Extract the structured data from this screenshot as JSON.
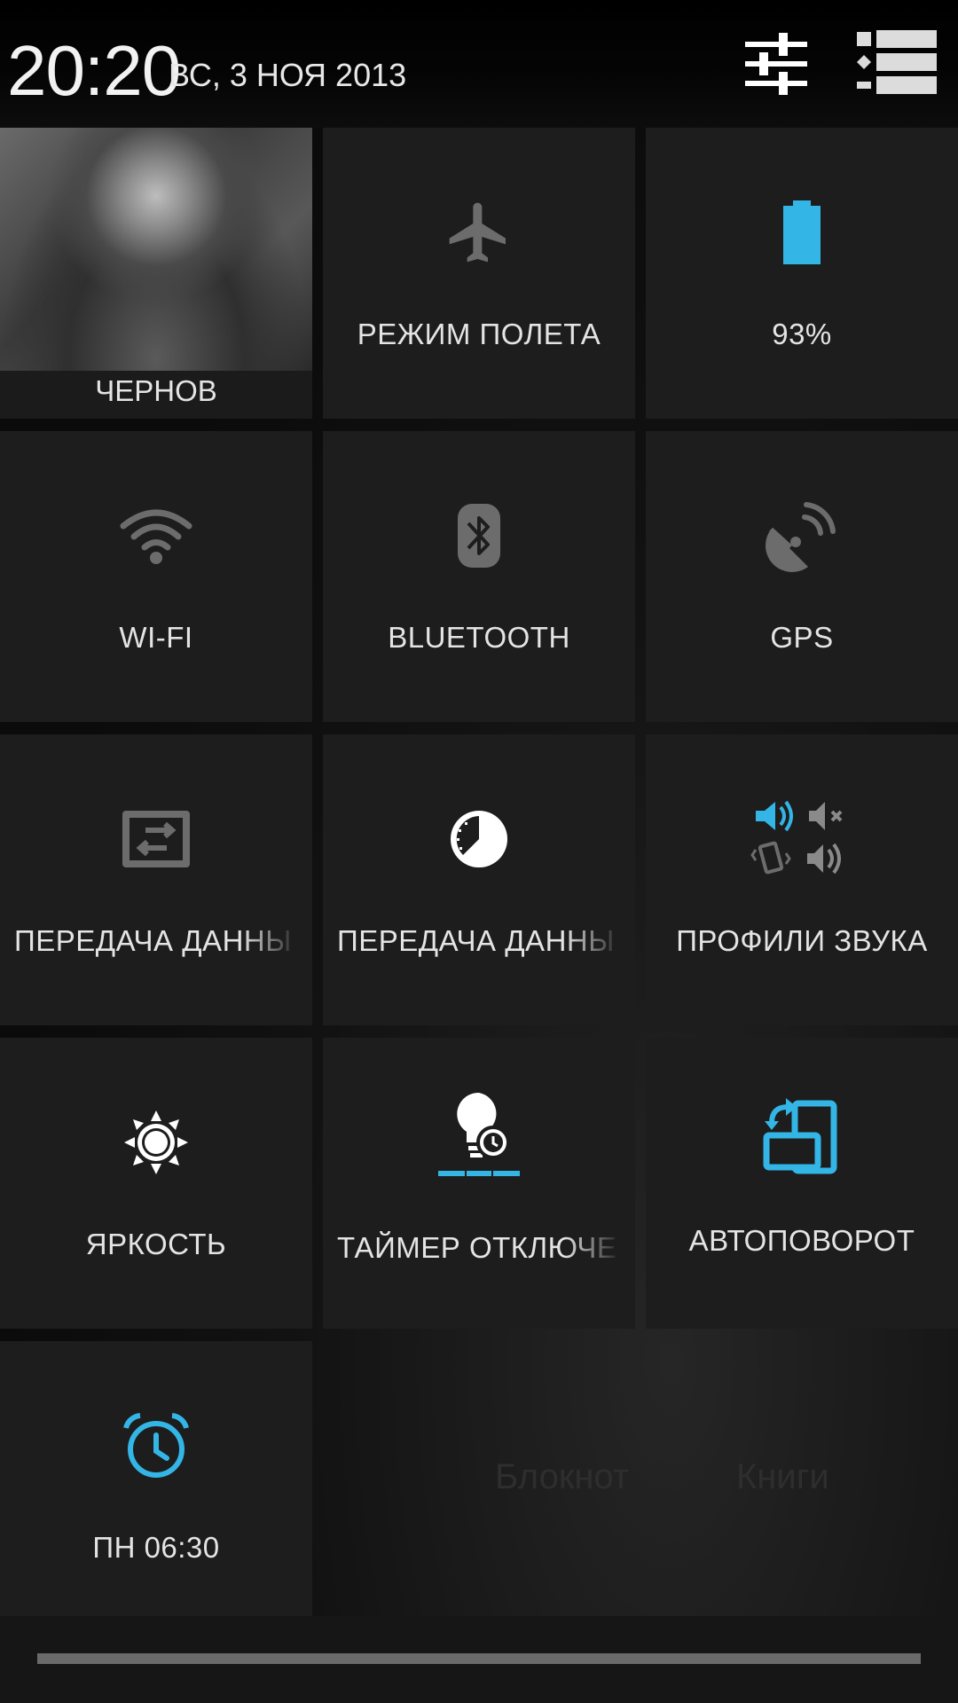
{
  "header": {
    "time": "20:20",
    "date": "ВС, 3 НОЯ 2013"
  },
  "tiles": {
    "user": "ЧЕРНОВ",
    "airplane": "РЕЖИМ ПОЛЕТА",
    "battery": "93%",
    "wifi": "WI-FI",
    "bluetooth": "BLUETOOTH",
    "gps": "GPS",
    "data1": "ПЕРЕДАЧА ДАННЫ",
    "data2": "ПЕРЕДАЧА ДАННЫ",
    "sound": "ПРОФИЛИ ЗВУКА",
    "brightness": "ЯРКОСТЬ",
    "timeout": "ТАЙМЕР ОТКЛЮЧЕ",
    "rotate": "АВТОПОВОРОТ",
    "alarm": "ПН 06:30"
  },
  "background": {
    "app1": "Блокнот",
    "app2": "Книги"
  },
  "colors": {
    "accent": "#33b5e5",
    "tile": "#1d1d1d",
    "icon_off": "#6c6c6c"
  }
}
